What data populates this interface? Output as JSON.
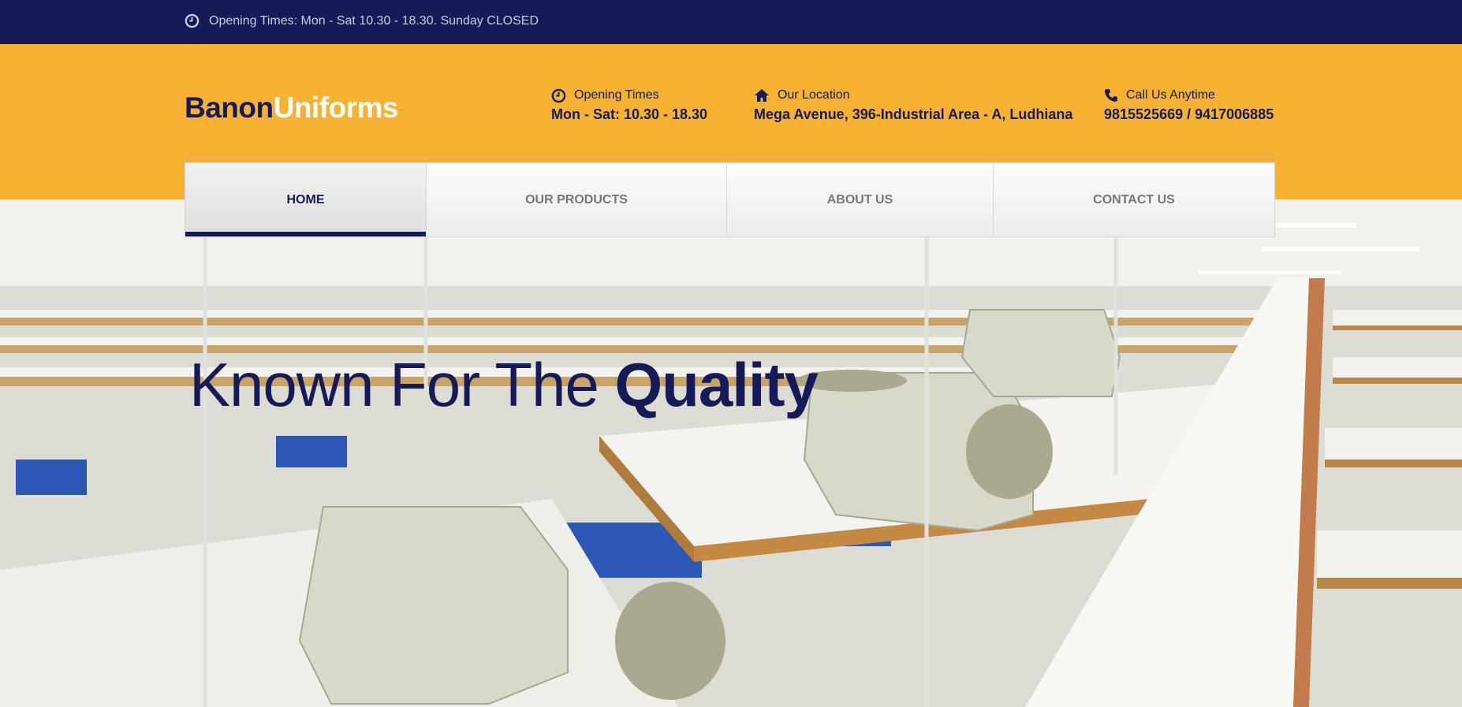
{
  "topbar": {
    "text": "Opening Times: Mon - Sat 10.30 - 18.30. Sunday CLOSED",
    "icon": "clock-icon"
  },
  "logo": {
    "part1": "Banon",
    "part2": "Uniforms"
  },
  "info": [
    {
      "icon": "clock-icon",
      "label": "Opening Times",
      "value": "Mon - Sat: 10.30 - 18.30"
    },
    {
      "icon": "home-icon",
      "label": "Our Location",
      "value": "Mega Avenue, 396-Industrial Area - A, Ludhiana"
    },
    {
      "icon": "phone-icon",
      "label": "Call Us Anytime",
      "value": "9815525669 / 9417006885"
    }
  ],
  "nav": [
    "HOME",
    "OUR PRODUCTS",
    "ABOUT US",
    "CONTACT US"
  ],
  "hero": {
    "title_light": "Known For The ",
    "title_bold": "Quality"
  },
  "colors": {
    "navy": "#161a57",
    "amber": "#f7b233"
  }
}
